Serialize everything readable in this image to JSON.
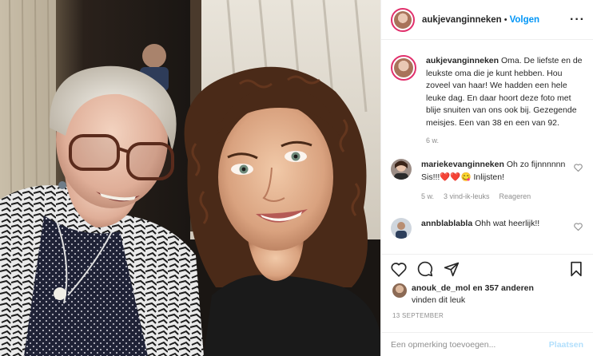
{
  "post": {
    "username": "aukjevanginneken",
    "follow_label": "Volgen",
    "more_icon": "more-horizontal-icon"
  },
  "caption": {
    "username": "aukjevanginneken",
    "text": "Oma. De liefste en de leukste oma die je kunt hebben. Hou zoveel van haar! We hadden een hele leuke dag. En daar hoort deze foto met blije snuiten van ons ook bij. Gezegende meisjes. Een van 38 en een van 92.",
    "age": "6 w."
  },
  "comments": [
    {
      "username": "mariekevanginneken",
      "text": "Oh zo fijnnnnnn Sis!!!❤️❤️😋 Inlijsten!",
      "age": "5 w.",
      "likes": "3 vind-ik-leuks",
      "reply": "Reageren"
    },
    {
      "username": "annblablabla",
      "text": "Ohh wat heerlijk!!"
    }
  ],
  "likes": {
    "user": "anouk_de_mol",
    "rest": "en 357 anderen",
    "line2": "vinden dit leuk"
  },
  "date": "13 SEPTEMBER",
  "add_comment": {
    "placeholder": "Een opmerking toevoegen...",
    "post_label": "Plaatsen"
  },
  "colors": {
    "accent": "#0095f6",
    "story_ring": "#e1306c",
    "muted": "#8e8e8e",
    "post_disabled": "#b2dffc"
  }
}
